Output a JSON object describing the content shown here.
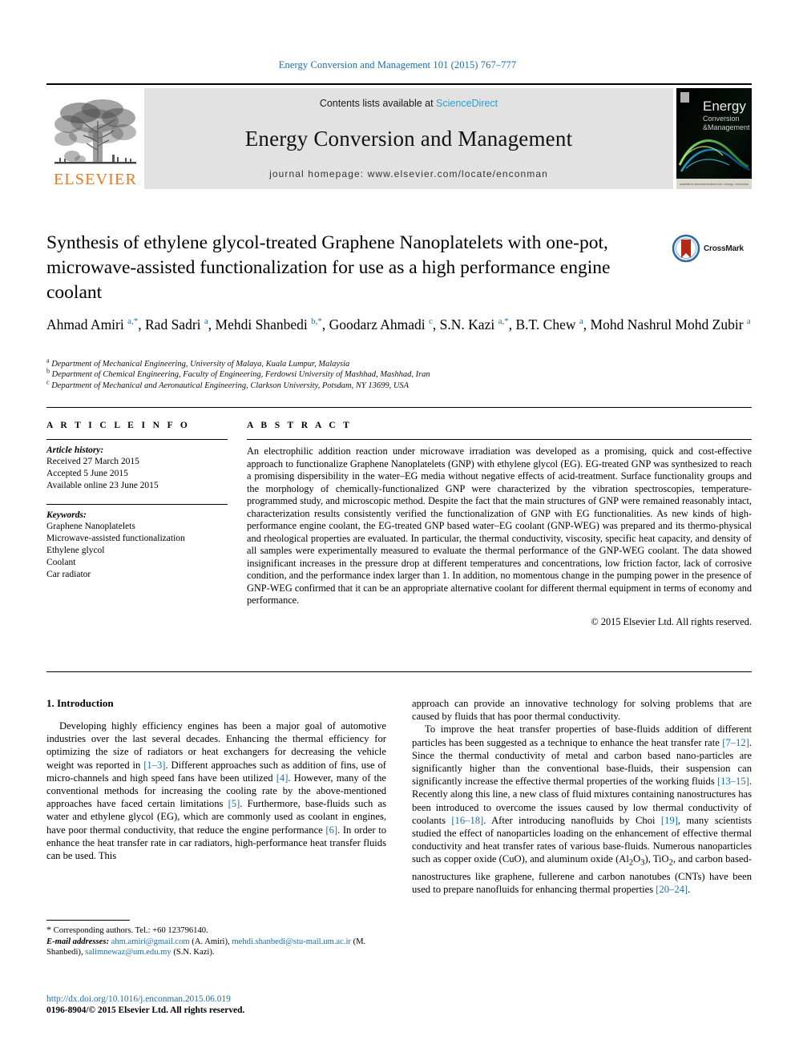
{
  "running_head": "Energy Conversion and Management 101 (2015) 767–777",
  "masthead": {
    "publisher": "ELSEVIER",
    "contents_prefix": "Contents lists available at ",
    "contents_link": "ScienceDirect",
    "journal_name": "Energy Conversion and Management",
    "homepage": "journal homepage: www.elsevier.com/locate/enconman",
    "cover_title_line1": "Energy",
    "cover_title_line2": "Conversion",
    "cover_title_line3": "&Management",
    "cover_footer": "available at www.sciencedirect.com • energy • conversion"
  },
  "article": {
    "title": "Synthesis of ethylene glycol-treated Graphene Nanoplatelets with one-pot, microwave-assisted functionalization for use as a high performance engine coolant",
    "crossmark_label": "CrossMark",
    "authors_html": "Ahmad Amiri <sup>a,*</sup>, Rad Sadri <sup>a</sup>, Mehdi Shanbedi <sup>b,*</sup>, Goodarz Ahmadi <sup>c</sup>, S.N. Kazi <sup>a,*</sup>, B.T. Chew <sup>a</sup>, Mohd Nashrul Mohd Zubir <sup>a</sup>",
    "affiliations": [
      {
        "mark": "a",
        "text": "Department of Mechanical Engineering, University of Malaya, Kuala Lumpur, Malaysia"
      },
      {
        "mark": "b",
        "text": "Department of Chemical Engineering, Faculty of Engineering, Ferdowsi University of Mashhad, Mashhad, Iran"
      },
      {
        "mark": "c",
        "text": "Department of Mechanical and Aeronautical Engineering, Clarkson University, Potsdam, NY 13699, USA"
      }
    ]
  },
  "article_info": {
    "heading": "A R T I C L E   I N F O",
    "history_label": "Article history:",
    "history": [
      "Received 27 March 2015",
      "Accepted 5 June 2015",
      "Available online 23 June 2015"
    ],
    "keywords_label": "Keywords:",
    "keywords": [
      "Graphene Nanoplatelets",
      "Microwave-assisted functionalization",
      "Ethylene glycol",
      "Coolant",
      "Car radiator"
    ]
  },
  "abstract": {
    "heading": "A B S T R A C T",
    "text": "An electrophilic addition reaction under microwave irradiation was developed as a promising, quick and cost-effective approach to functionalize Graphene Nanoplatelets (GNP) with ethylene glycol (EG). EG-treated GNP was synthesized to reach a promising dispersibility in the water–EG media without negative effects of acid-treatment. Surface functionality groups and the morphology of chemically-functionalized GNP were characterized by the vibration spectroscopies, temperature-programmed study, and microscopic method. Despite the fact that the main structures of GNP were remained reasonably intact, characterization results consistently verified the functionalization of GNP with EG functionalities. As new kinds of high-performance engine coolant, the EG-treated GNP based water–EG coolant (GNP-WEG) was prepared and its thermo-physical and rheological properties are evaluated. In particular, the thermal conductivity, viscosity, specific heat capacity, and density of all samples were experimentally measured to evaluate the thermal performance of the GNP-WEG coolant. The data showed insignificant increases in the pressure drop at different temperatures and concentrations, low friction factor, lack of corrosive condition, and the performance index larger than 1. In addition, no momentous change in the pumping power in the presence of GNP-WEG confirmed that it can be an appropriate alternative coolant for different thermal equipment in terms of economy and performance.",
    "copyright": "© 2015 Elsevier Ltd. All rights reserved."
  },
  "body": {
    "section_heading": "1. Introduction",
    "col1_para1_html": "Developing highly efficiency engines has been a major goal of automotive industries over the last several decades. Enhancing the thermal efficiency for optimizing the size of radiators or heat exchangers for decreasing the vehicle weight was reported in <span class=\"ref\">[1–3]</span>. Different approaches such as addition of fins, use of micro-channels and high speed fans have been utilized <span class=\"ref\">[4]</span>. However, many of the conventional methods for increasing the cooling rate by the above-mentioned approaches have faced certain limitations <span class=\"ref\">[5]</span>. Furthermore, base-fluids such as water and ethylene glycol (EG), which are commonly used as coolant in engines, have poor thermal conductivity, that reduce the engine performance <span class=\"ref\">[6]</span>. In order to enhance the heat transfer rate in car radiators, high-performance heat transfer fluids can be used. This",
    "col2_para1_html": "approach can provide an innovative technology for solving problems that are caused by fluids that has poor thermal conductivity.",
    "col2_para2_html": "To improve the heat transfer properties of base-fluids addition of different particles has been suggested as a technique to enhance the heat transfer rate <span class=\"ref\">[7–12]</span>. Since the thermal conductivity of metal and carbon based nano-particles are significantly higher than the conventional base-fluids, their suspension can significantly increase the effective thermal properties of the working fluids <span class=\"ref\">[13–15]</span>. Recently along this line, a new class of fluid mixtures containing nanostructures has been introduced to overcome the issues caused by low thermal conductivity of coolants <span class=\"ref\">[16–18]</span>. After introducing nanofluids by Choi <span class=\"ref\">[19]</span>, many scientists studied the effect of nanoparticles loading on the enhancement of effective thermal conductivity and heat transfer rates of various base-fluids. Numerous nanoparticles such as copper oxide (CuO), and aluminum oxide (Al<sub>2</sub>O<sub>3</sub>), TiO<sub>2</sub>, and carbon based-nanostructures like graphene, fullerene and carbon nanotubes (CNTs) have been used to prepare nanofluids for enhancing thermal properties <span class=\"ref\">[20–24]</span>."
  },
  "footnotes": {
    "corresponding_html": "<span style=\"font-size:12px\">*</span> Corresponding authors. Tel.: +60 123796140.",
    "email_html": "<span class=\"em\">E-mail addresses:</span> <span class=\"link\">ahm.amiri@gmail.com</span> (A. Amiri), <span class=\"link\">mehdi.shanbedi@stu-mail.um.ac.ir</span> (M. Shanbedi), <span class=\"link\">salimnewaz@um.edu.my</span> (S.N. Kazi).",
    "doi": "http://dx.doi.org/10.1016/j.enconman.2015.06.019",
    "issn": "0196-8904/© 2015 Elsevier Ltd. All rights reserved."
  }
}
